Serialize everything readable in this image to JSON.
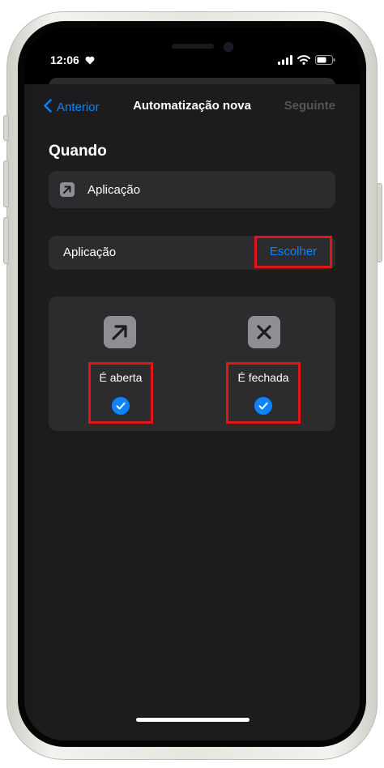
{
  "status_bar": {
    "time": "12:06"
  },
  "nav": {
    "back_label": "Anterior",
    "title": "Automatização nova",
    "next_label": "Seguinte"
  },
  "section": {
    "title": "Quando"
  },
  "trigger_row": {
    "label": "Aplicação",
    "icon": "arrow-up-right-icon"
  },
  "app_picker": {
    "label": "Aplicação",
    "choose_label": "Escolher"
  },
  "options": [
    {
      "label": "É aberta",
      "icon": "arrow-up-right-icon",
      "checked": true
    },
    {
      "label": "É fechada",
      "icon": "x-icon",
      "checked": true
    }
  ],
  "colors": {
    "accent": "#0a84ff",
    "highlight": "#e3141b",
    "background": "#1c1c1e",
    "cell": "#2c2c2e"
  }
}
